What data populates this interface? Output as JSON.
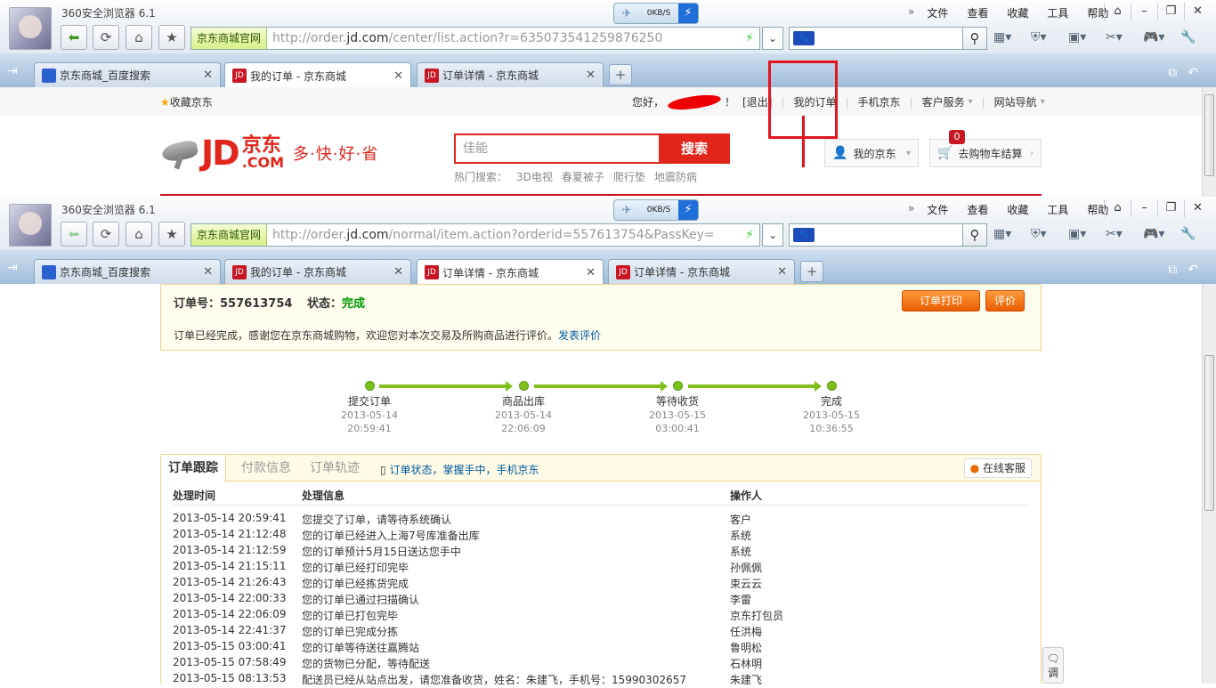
{
  "browser": {
    "app_title": "360安全浏览器 6.1",
    "speed": "0KB/S",
    "menus": [
      "文件",
      "查看",
      "收藏",
      "工具",
      "帮助"
    ],
    "site_tag": "京东商城官网",
    "search_engine": "百度"
  },
  "window1": {
    "url_pre": "http://order.",
    "url_domain": "jd.com",
    "url_post": "/center/list.action?r=635073541259876250",
    "tabs": [
      {
        "title": "京东商城_百度搜索",
        "icon": "baidu-icon"
      },
      {
        "title": "我的订单 - 京东商城",
        "icon": "jd-icon",
        "active": true
      },
      {
        "title": "订单详情 - 京东商城",
        "icon": "jd-icon"
      }
    ]
  },
  "window2": {
    "url_pre": "http://order.",
    "url_domain": "jd.com",
    "url_post": "/normal/item.action?orderid=557613754&PassKey=",
    "tabs": [
      {
        "title": "京东商城_百度搜索",
        "icon": "baidu-icon"
      },
      {
        "title": "我的订单 - 京东商城",
        "icon": "jd-icon"
      },
      {
        "title": "订单详情 - 京东商城",
        "icon": "jd-icon",
        "active": true
      },
      {
        "title": "订单详情 - 京东商城",
        "icon": "jd-icon"
      }
    ]
  },
  "jd_header": {
    "favorite": "收藏京东",
    "greeting": "您好，",
    "greeting_end": "！",
    "logout": "[退出]",
    "my_orders": "我的订单",
    "mobile": "手机京东",
    "service": "客户服务",
    "site_nav": "网站导航",
    "logo_mark": "JD",
    "logo_cn": "京东",
    "logo_com": ".COM",
    "slogan": "多·快·好·省",
    "search_value": "佳能",
    "search_button": "搜索",
    "hot_label": "热门搜索：",
    "hot_items": [
      "3D电视",
      "春夏被子",
      "爬行垫",
      "地震防病"
    ],
    "my_jd": "我的京东",
    "cart": "去购物车结算",
    "cart_count": "0"
  },
  "order": {
    "number_label": "订单号：",
    "number": "557613754",
    "status_label": "状态：",
    "status": "完成",
    "print_button": "订单打印",
    "review_button": "评价",
    "message": "订单已经完成，感谢您在京东商城购物，欢迎您对本次交易及所购商品进行评价。",
    "review_link": "发表评价"
  },
  "progress": [
    {
      "label": "提交订单",
      "date": "2013-05-14",
      "time": "20:59:41"
    },
    {
      "label": "商品出库",
      "date": "2013-05-14",
      "time": "22:06:09"
    },
    {
      "label": "等待收货",
      "date": "2013-05-15",
      "time": "03:00:41"
    },
    {
      "label": "完成",
      "date": "2013-05-15",
      "time": "10:36:55"
    }
  ],
  "tracking": {
    "tabs": [
      "订单跟踪",
      "付款信息",
      "订单轨迹"
    ],
    "promo": "订单状态，掌握手中，手机京东",
    "online_service": "在线客服",
    "headers": [
      "处理时间",
      "处理信息",
      "操作人"
    ],
    "rows": [
      [
        "2013-05-14 20:59:41",
        "您提交了订单，请等待系统确认",
        "客户"
      ],
      [
        "2013-05-14 21:12:48",
        "您的订单已经进入上海7号库准备出库",
        "系统"
      ],
      [
        "2013-05-14 21:12:59",
        "您的订单预计5月15日送达您手中",
        "系统"
      ],
      [
        "2013-05-14 21:15:11",
        "您的订单已经打印完毕",
        "孙佩佩"
      ],
      [
        "2013-05-14 21:26:43",
        "您的订单已经拣货完成",
        "束云云"
      ],
      [
        "2013-05-14 22:00:33",
        "您的订单已通过扫描确认",
        "李雷"
      ],
      [
        "2013-05-14 22:06:09",
        "您的订单已打包完毕",
        "京东打包员"
      ],
      [
        "2013-05-14 22:41:37",
        "您的订单已完成分拣",
        "任洪梅"
      ],
      [
        "2013-05-15 03:00:41",
        "您的订单等待送往嘉腾站",
        "鲁明松"
      ],
      [
        "2013-05-15 07:58:49",
        "您的货物已分配，等待配送",
        "石林明"
      ],
      [
        "2013-05-15 08:13:53",
        "配送员已经从站点出发，请您准备收货，姓名：朱建飞，手机号：15990302657",
        "朱建飞"
      ]
    ]
  },
  "feedback_label": "调"
}
